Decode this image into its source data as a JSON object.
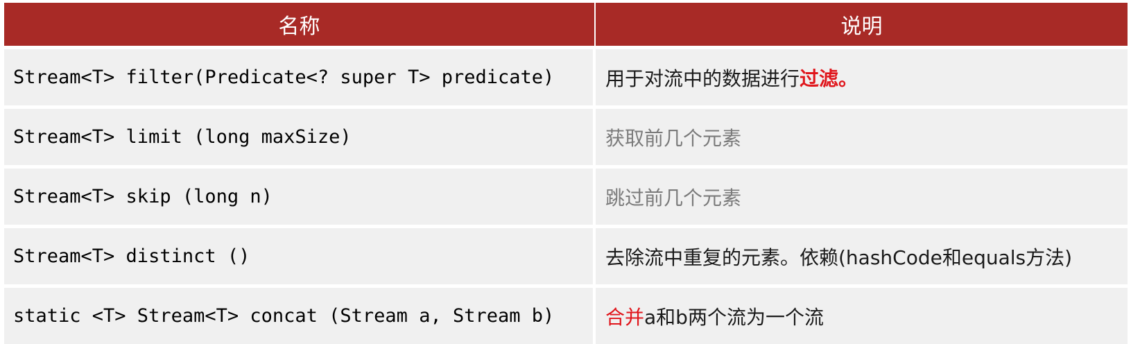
{
  "header": {
    "name": "名称",
    "description": "说明"
  },
  "rows": [
    {
      "method": "Stream<T> filter(Predicate<? super T> predicate)",
      "desc_a": "用于对流中的数据进行",
      "desc_b": "过滤。"
    },
    {
      "method": "Stream<T> limit (long maxSize)",
      "desc": "获取前几个元素"
    },
    {
      "method": "Stream<T> skip (long n)",
      "desc": "跳过前几个元素"
    },
    {
      "method": "Stream<T> distinct ()",
      "desc": "去除流中重复的元素。依赖(hashCode和equals方法)"
    },
    {
      "method": "static <T> Stream<T> concat (Stream a, Stream b)",
      "desc_a": "合并",
      "desc_b": "a和b两个流为一个流"
    }
  ],
  "colors": {
    "header_bg": "#a82a26",
    "row_bg": "#f0f0f0",
    "highlight": "#e0151b",
    "muted_text": "#7a7a7a"
  }
}
